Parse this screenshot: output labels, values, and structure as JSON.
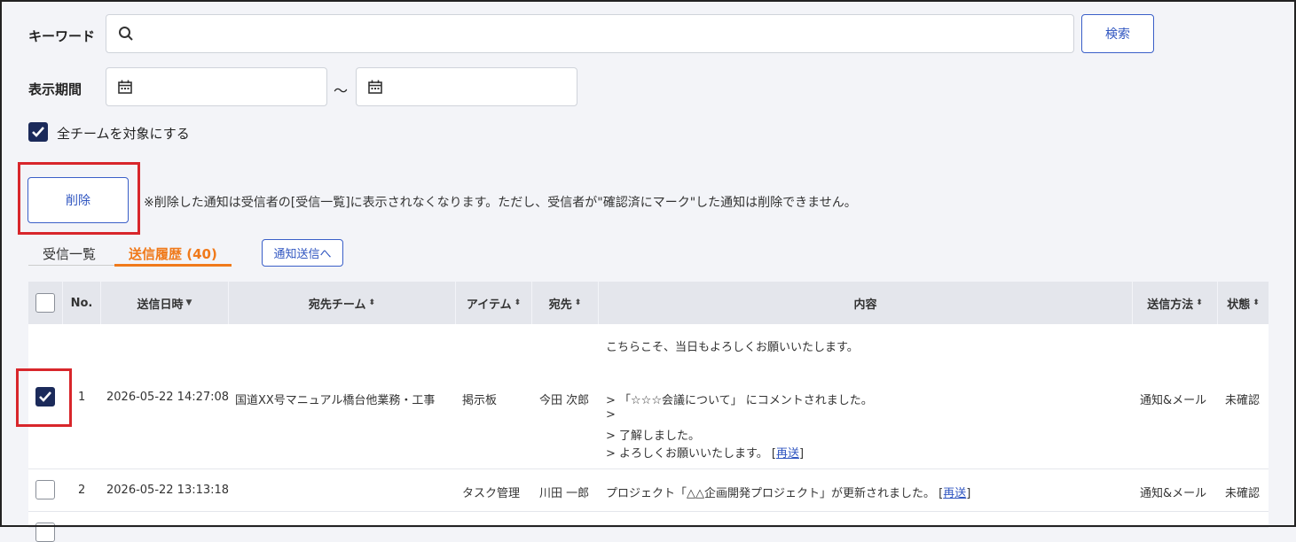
{
  "filters": {
    "keyword_label": "キーワード",
    "keyword_value": "",
    "search_button": "検索",
    "period_label": "表示期間",
    "period_from": "",
    "period_to": "",
    "period_separator": "〜",
    "all_teams_label": "全チームを対象にする",
    "all_teams_checked": true
  },
  "actions": {
    "delete_button": "削除",
    "delete_note": "※削除した通知は受信者の[受信一覧]に表示されなくなります。ただし、受信者が\"確認済にマーク\"した通知は削除できません。"
  },
  "tabs": [
    {
      "label": "受信一覧",
      "active": false
    },
    {
      "label": "送信履歴 (40)",
      "active": true
    }
  ],
  "send_notice_button": "通知送信へ",
  "table": {
    "headers": {
      "no": "No.",
      "sent_at": "送信日時",
      "team": "宛先チーム",
      "item": "アイテム",
      "recipient": "宛先",
      "content": "内容",
      "method": "送信方法",
      "status": "状態"
    },
    "rows": [
      {
        "checked": true,
        "no": "1",
        "sent_at": "2026-05-22 14:27:08",
        "team": "国道XX号マニュアル橋台他業務・工事",
        "item": "掲示板",
        "recipient": "今田 次郎",
        "content_lines": [
          "こちらこそ、当日もよろしくお願いいたします。",
          "",
          "> 「☆☆☆会議について」 にコメントされました。",
          ">",
          "> 了解しました。",
          "> よろしくお願いいたします。"
        ],
        "resend": "再送",
        "method": "通知&メール",
        "status": "未確認"
      },
      {
        "checked": false,
        "no": "2",
        "sent_at": "2026-05-22 13:13:18",
        "team": "",
        "item": "タスク管理",
        "recipient": "川田 一郎",
        "content_lines": [
          "プロジェクト「△△企画開発プロジェクト」が更新されました。"
        ],
        "resend": "再送",
        "method": "通知&メール",
        "status": "未確認"
      }
    ]
  },
  "colors": {
    "accent": "#2f55c0",
    "active_tab": "#f07a1b",
    "highlight_red": "#d8262b",
    "checkbox_checked": "#1b2a5a"
  }
}
